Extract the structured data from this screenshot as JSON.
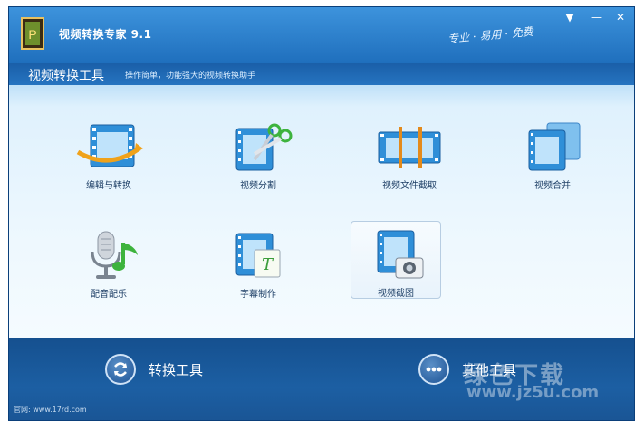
{
  "window": {
    "title": "视频转换专家 9.1",
    "slogan": "专业 · 易用 · 免费",
    "controls": [
      "▼",
      "—",
      "✕"
    ]
  },
  "subheader": {
    "title": "视频转换工具",
    "description": "操作简单，功能强大的视频转换助手"
  },
  "tools": [
    {
      "label": "编辑与转换",
      "icon": "film-edit-convert-icon"
    },
    {
      "label": "视频分割",
      "icon": "film-scissors-icon"
    },
    {
      "label": "视频文件截取",
      "icon": "film-cut-icon"
    },
    {
      "label": "视频合并",
      "icon": "film-merge-icon"
    },
    {
      "label": "配音配乐",
      "icon": "microphone-music-icon"
    },
    {
      "label": "字幕制作",
      "icon": "film-subtitle-icon"
    },
    {
      "label": "视频截图",
      "icon": "film-camera-icon",
      "selected": true
    }
  ],
  "bottom": {
    "convert_label": "转换工具",
    "other_label": "其他工具"
  },
  "footer": {
    "site": "官网: www.17rd.com"
  },
  "watermark": {
    "line1": "绿色下载",
    "line2": "www.jz5u.com"
  },
  "colors": {
    "titlebar": "#1f6fbd",
    "bottom": "#1c5fa3",
    "label": "#1e3f66"
  }
}
